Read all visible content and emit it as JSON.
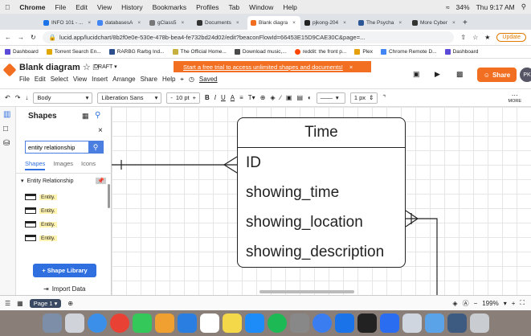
{
  "menubar": {
    "app": "Chrome",
    "items": [
      "File",
      "Edit",
      "View",
      "History",
      "Bookmarks",
      "Profiles",
      "Tab",
      "Window",
      "Help"
    ],
    "battery": "34%",
    "clock": "Thu 9:17 AM"
  },
  "tabs": [
    {
      "label": "INFO 101 - ...",
      "color": "#1a73e8"
    },
    {
      "label": "databasesA",
      "color": "#4285f4"
    },
    {
      "label": "gClass5",
      "color": "#777777"
    },
    {
      "label": "Documents",
      "color": "#333333"
    },
    {
      "label": "Blank diagra",
      "color": "#f26f21",
      "active": true
    },
    {
      "label": "pjkong-204",
      "color": "#222222"
    },
    {
      "label": "The Psycha",
      "color": "#2b5797"
    },
    {
      "label": "More Cyber",
      "color": "#333333"
    }
  ],
  "address": {
    "url": "lucid.app/lucidchart/8b2f0e0e-530e-478b-bea4-fe732bd24d02/edit?beaconFlowId=66453E15D9CAE30C&page=...",
    "update_label": "Update"
  },
  "bookmarks": [
    {
      "label": "Dashboard",
      "color": "#5b4ad8"
    },
    {
      "label": "Torrent Search En...",
      "color": "#e0a800"
    },
    {
      "label": "RARBG Rarbg Ind...",
      "color": "#2d4e8c"
    },
    {
      "label": "The Official Home...",
      "color": "#c8b040"
    },
    {
      "label": "Download music,...",
      "color": "#4a4a4a"
    },
    {
      "label": "reddit: the front p...",
      "color": "#ff4500"
    },
    {
      "label": "Plex",
      "color": "#e5a00d"
    },
    {
      "label": "Chrome Remote D...",
      "color": "#4285f4"
    },
    {
      "label": "Dashboard",
      "color": "#5b4ad8"
    }
  ],
  "lucid": {
    "title": "Blank diagram",
    "draft": "DRAFT",
    "menu": [
      "File",
      "Edit",
      "Select",
      "View",
      "Insert",
      "Arrange",
      "Share",
      "Help"
    ],
    "saved": "Saved",
    "banner": "Start a free trial to access unlimited shapes and documents!",
    "share": "Share",
    "avatar": "PK"
  },
  "toolbar": {
    "style": "Body",
    "font": "Liberation Sans",
    "size": "10 pt",
    "line_width": "1 px",
    "more": "MORE"
  },
  "panel": {
    "title": "Shapes",
    "search_value": "entity relationship",
    "tabs": [
      "Shapes",
      "Images",
      "Icons"
    ],
    "library": "Entity Relationship",
    "entities": [
      "Entity.",
      "Entity.",
      "Entity.",
      "Entity."
    ],
    "shape_library": "+ Shape Library",
    "import_data": "Import Data"
  },
  "diagram": {
    "entity_name": "Time",
    "fields": [
      "ID",
      "showing_time",
      "showing_location",
      "showing_description"
    ]
  },
  "bottom": {
    "page": "Page 1",
    "zoom": "199%"
  }
}
